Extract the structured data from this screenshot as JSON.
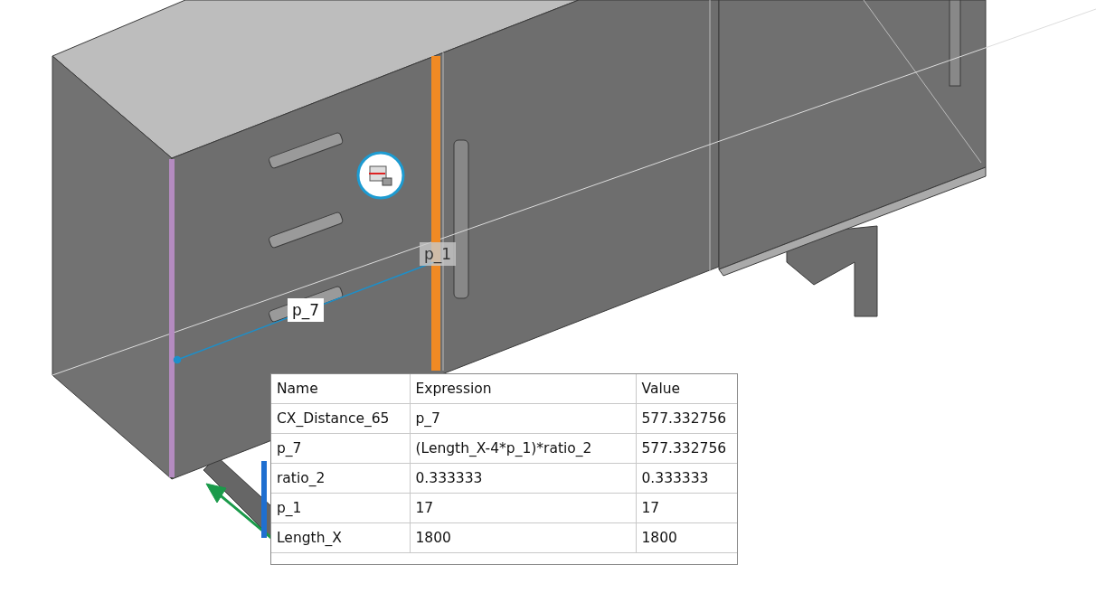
{
  "viewport": {
    "dimension_labels": [
      {
        "text": "p_1",
        "highlighted": true
      },
      {
        "text": "p_7",
        "highlighted": false
      }
    ],
    "parameter_table": {
      "columns": [
        "Name",
        "Expression",
        "Value"
      ],
      "rows": [
        [
          "CX_Distance_65",
          "p_7",
          "577.332756"
        ],
        [
          "p_7",
          "(Length_X-4*p_1)*ratio_2",
          "577.332756"
        ],
        [
          "ratio_2",
          "0.333333",
          "0.333333"
        ],
        [
          "p_1",
          "17",
          "17"
        ],
        [
          "Length_X",
          "1800",
          "1800"
        ]
      ]
    }
  }
}
